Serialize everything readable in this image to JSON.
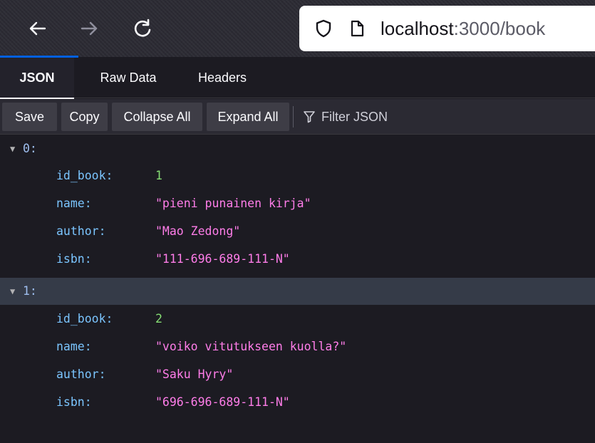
{
  "browser": {
    "url_host": "localhost",
    "url_rest": ":3000/book"
  },
  "tabs": [
    {
      "label": "JSON",
      "selected": true
    },
    {
      "label": "Raw Data",
      "selected": false
    },
    {
      "label": "Headers",
      "selected": false
    }
  ],
  "toolbar": {
    "save": "Save",
    "copy": "Copy",
    "collapse_all": "Collapse All",
    "expand_all": "Expand All",
    "filter_placeholder": "Filter JSON"
  },
  "records": [
    {
      "index": "0:",
      "fields": [
        {
          "key": "id_book:",
          "value": "1",
          "type": "number"
        },
        {
          "key": "name:",
          "value": "\"pieni punainen kirja\"",
          "type": "string"
        },
        {
          "key": "author:",
          "value": "\"Mao Zedong\"",
          "type": "string"
        },
        {
          "key": "isbn:",
          "value": "\"111-696-689-111-N\"",
          "type": "string"
        }
      ]
    },
    {
      "index": "1:",
      "fields": [
        {
          "key": "id_book:",
          "value": "2",
          "type": "number"
        },
        {
          "key": "name:",
          "value": "\"voiko vitutukseen kuolla?\"",
          "type": "string"
        },
        {
          "key": "author:",
          "value": "\"Saku Hyry\"",
          "type": "string"
        },
        {
          "key": "isbn:",
          "value": "\"696-696-689-111-N\"",
          "type": "string"
        }
      ]
    }
  ],
  "colors": {
    "key": "#7bc5ff",
    "number": "#86de74",
    "string": "#ff7de9",
    "selected_row": "#353b48"
  },
  "icons": {
    "back": "back-arrow-icon",
    "forward": "forward-arrow-icon",
    "reload": "reload-icon",
    "tracking": "shield-icon",
    "page": "page-icon",
    "filter": "funnel-icon",
    "twisty": "triangle-down-icon"
  }
}
